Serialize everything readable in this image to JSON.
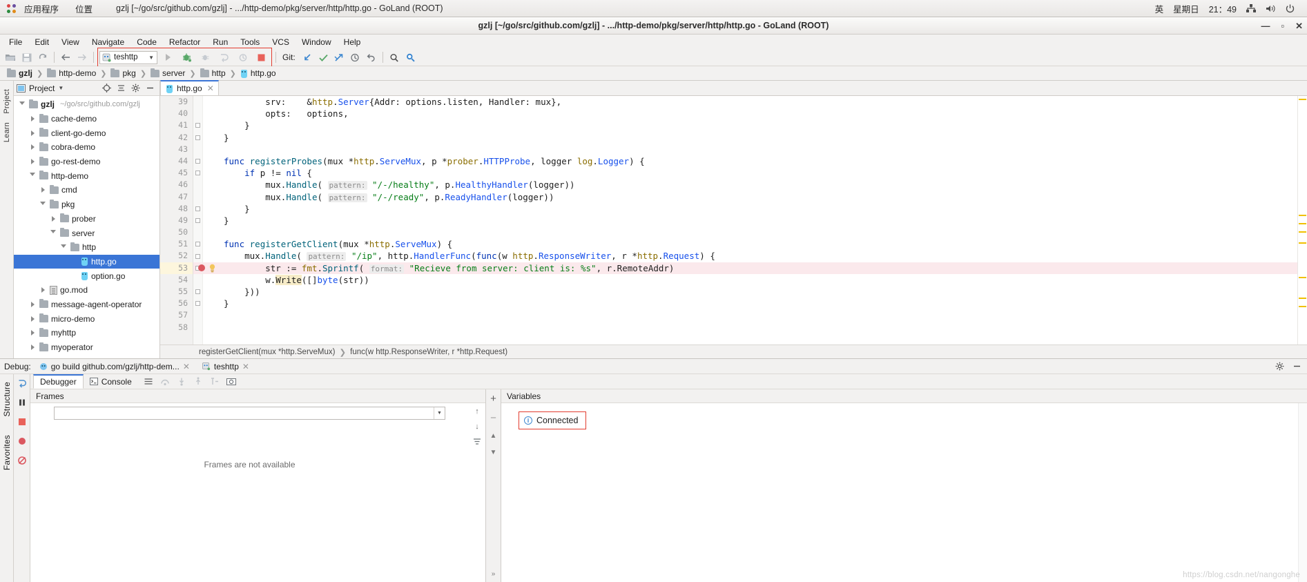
{
  "desktop": {
    "applications_label": "应用程序",
    "places_label": "位置",
    "window_title": "gzlj [~/go/src/github.com/gzlj] - .../http-demo/pkg/server/http/http.go - GoLand (ROOT)",
    "input_method": "英",
    "day": "星期日",
    "time": "21：49",
    "icons": {
      "apps": "apps-grid-icon",
      "network": "network-icon",
      "volume": "volume-icon",
      "power": "power-icon"
    }
  },
  "ide": {
    "title": "gzlj [~/go/src/github.com/gzlj] - .../http-demo/pkg/server/http/http.go - GoLand (ROOT)",
    "window_buttons": {
      "minimize": "—",
      "maximize": "▫",
      "close": "✕"
    },
    "menu": [
      "File",
      "Edit",
      "View",
      "Navigate",
      "Code",
      "Refactor",
      "Run",
      "Tools",
      "VCS",
      "Window",
      "Help"
    ],
    "toolbar": {
      "run_config": "teshttp",
      "git_label": "Git:",
      "icons": [
        "open-folder-icon",
        "save-all-icon",
        "sync-icon",
        "back-arrow-icon",
        "forward-arrow-icon",
        "run-icon",
        "debug-icon",
        "run-with-coverage-icon",
        "rerun-icon",
        "profile-icon",
        "stop-icon",
        "git-update-icon",
        "git-commit-icon",
        "git-push-icon",
        "git-history-icon",
        "git-revert-icon",
        "search-everywhere-icon",
        "find-icon"
      ]
    },
    "breadcrumbs": [
      "gzlj",
      "http-demo",
      "pkg",
      "server",
      "http",
      "http.go"
    ]
  },
  "project_panel": {
    "title": "Project",
    "header_icons": [
      "locate-icon",
      "collapse-all-icon",
      "settings-icon",
      "hide-icon"
    ],
    "tree": [
      {
        "label": "gzlj",
        "path": "~/go/src/github.com/gzlj",
        "depth": 0,
        "icon": "folder-icon",
        "state": "open",
        "bold": true,
        "selected": false
      },
      {
        "label": "cache-demo",
        "path": "",
        "depth": 1,
        "icon": "folder-icon",
        "state": "closed",
        "bold": false,
        "selected": false
      },
      {
        "label": "client-go-demo",
        "path": "",
        "depth": 1,
        "icon": "folder-icon",
        "state": "closed",
        "bold": false,
        "selected": false
      },
      {
        "label": "cobra-demo",
        "path": "",
        "depth": 1,
        "icon": "folder-icon",
        "state": "closed",
        "bold": false,
        "selected": false
      },
      {
        "label": "go-rest-demo",
        "path": "",
        "depth": 1,
        "icon": "folder-icon",
        "state": "closed",
        "bold": false,
        "selected": false
      },
      {
        "label": "http-demo",
        "path": "",
        "depth": 1,
        "icon": "folder-icon",
        "state": "open",
        "bold": false,
        "selected": false
      },
      {
        "label": "cmd",
        "path": "",
        "depth": 2,
        "icon": "folder-icon",
        "state": "closed",
        "bold": false,
        "selected": false
      },
      {
        "label": "pkg",
        "path": "",
        "depth": 2,
        "icon": "folder-icon",
        "state": "open",
        "bold": false,
        "selected": false
      },
      {
        "label": "prober",
        "path": "",
        "depth": 3,
        "icon": "folder-icon",
        "state": "closed",
        "bold": false,
        "selected": false
      },
      {
        "label": "server",
        "path": "",
        "depth": 3,
        "icon": "folder-icon",
        "state": "open",
        "bold": false,
        "selected": false
      },
      {
        "label": "http",
        "path": "",
        "depth": 4,
        "icon": "folder-icon",
        "state": "open",
        "bold": false,
        "selected": false
      },
      {
        "label": "http.go",
        "path": "",
        "depth": 5,
        "icon": "go-file-icon",
        "state": "none",
        "bold": false,
        "selected": true
      },
      {
        "label": "option.go",
        "path": "",
        "depth": 5,
        "icon": "go-file-icon",
        "state": "none",
        "bold": false,
        "selected": false
      },
      {
        "label": "go.mod",
        "path": "",
        "depth": 2,
        "icon": "go-mod-icon",
        "state": "closed",
        "bold": false,
        "selected": false
      },
      {
        "label": "message-agent-operator",
        "path": "",
        "depth": 1,
        "icon": "folder-icon",
        "state": "closed",
        "bold": false,
        "selected": false
      },
      {
        "label": "micro-demo",
        "path": "",
        "depth": 1,
        "icon": "folder-icon",
        "state": "closed",
        "bold": false,
        "selected": false
      },
      {
        "label": "myhttp",
        "path": "",
        "depth": 1,
        "icon": "folder-icon",
        "state": "closed",
        "bold": false,
        "selected": false
      },
      {
        "label": "myoperator",
        "path": "",
        "depth": 1,
        "icon": "folder-icon",
        "state": "closed",
        "bold": false,
        "selected": false
      }
    ]
  },
  "left_strip": [
    "Project",
    "Learn"
  ],
  "bottom_left_strip": [
    "Structure",
    "Favorites"
  ],
  "editor": {
    "tab": {
      "label": "http.go",
      "icon": "go-file-icon",
      "close": "✕"
    },
    "first_line": 39,
    "lines": [
      {
        "n": 39,
        "tokens": [
          {
            "t": "        srv:    &",
            "c": "pln"
          },
          {
            "t": "http",
            "c": "pkgv"
          },
          {
            "t": ".",
            "c": "pln"
          },
          {
            "t": "Server",
            "c": "typ"
          },
          {
            "t": "{Addr: options.listen, Handler: mux},",
            "c": "pln"
          }
        ]
      },
      {
        "n": 40,
        "tokens": [
          {
            "t": "        opts:   options,",
            "c": "pln"
          }
        ]
      },
      {
        "n": 41,
        "tokens": [
          {
            "t": "    }",
            "c": "pln"
          }
        ]
      },
      {
        "n": 42,
        "tokens": [
          {
            "t": "}",
            "c": "pln"
          }
        ]
      },
      {
        "n": 43,
        "tokens": []
      },
      {
        "n": 44,
        "tokens": [
          {
            "t": "func ",
            "c": "kw"
          },
          {
            "t": "registerProbes",
            "c": "fn"
          },
          {
            "t": "(mux *",
            "c": "pln"
          },
          {
            "t": "http",
            "c": "pkgv"
          },
          {
            "t": ".",
            "c": "pln"
          },
          {
            "t": "ServeMux",
            "c": "typ"
          },
          {
            "t": ", p *",
            "c": "pln"
          },
          {
            "t": "prober",
            "c": "pkgv"
          },
          {
            "t": ".",
            "c": "pln"
          },
          {
            "t": "HTTPProbe",
            "c": "typ"
          },
          {
            "t": ", logger ",
            "c": "pln"
          },
          {
            "t": "log",
            "c": "pkgv"
          },
          {
            "t": ".",
            "c": "pln"
          },
          {
            "t": "Logger",
            "c": "typ"
          },
          {
            "t": ") {",
            "c": "pln"
          }
        ]
      },
      {
        "n": 45,
        "tokens": [
          {
            "t": "    ",
            "c": "pln"
          },
          {
            "t": "if",
            "c": "kw"
          },
          {
            "t": " p != ",
            "c": "pln"
          },
          {
            "t": "nil",
            "c": "kw"
          },
          {
            "t": " {",
            "c": "pln"
          }
        ]
      },
      {
        "n": 46,
        "tokens": [
          {
            "t": "        mux.",
            "c": "pln"
          },
          {
            "t": "Handle",
            "c": "fn"
          },
          {
            "t": "( ",
            "c": "pln"
          },
          {
            "t": "pattern:",
            "c": "hint"
          },
          {
            "t": " ",
            "c": "pln"
          },
          {
            "t": "\"/-/healthy\"",
            "c": "str"
          },
          {
            "t": ", p.",
            "c": "pln"
          },
          {
            "t": "HealthyHandler",
            "c": "typ"
          },
          {
            "t": "(logger))",
            "c": "pln"
          }
        ]
      },
      {
        "n": 47,
        "tokens": [
          {
            "t": "        mux.",
            "c": "pln"
          },
          {
            "t": "Handle",
            "c": "fn"
          },
          {
            "t": "( ",
            "c": "pln"
          },
          {
            "t": "pattern:",
            "c": "hint"
          },
          {
            "t": " ",
            "c": "pln"
          },
          {
            "t": "\"/-/ready\"",
            "c": "str"
          },
          {
            "t": ", p.",
            "c": "pln"
          },
          {
            "t": "ReadyHandler",
            "c": "typ"
          },
          {
            "t": "(logger))",
            "c": "pln"
          }
        ]
      },
      {
        "n": 48,
        "tokens": [
          {
            "t": "    }",
            "c": "pln"
          }
        ]
      },
      {
        "n": 49,
        "tokens": [
          {
            "t": "}",
            "c": "pln"
          }
        ]
      },
      {
        "n": 50,
        "tokens": []
      },
      {
        "n": 51,
        "tokens": [
          {
            "t": "func ",
            "c": "kw"
          },
          {
            "t": "registerGetClient",
            "c": "fn"
          },
          {
            "t": "(mux *",
            "c": "pln"
          },
          {
            "t": "http",
            "c": "pkgv"
          },
          {
            "t": ".",
            "c": "pln"
          },
          {
            "t": "ServeMux",
            "c": "typ"
          },
          {
            "t": ") {",
            "c": "pln"
          }
        ]
      },
      {
        "n": 52,
        "tokens": [
          {
            "t": "    mux.",
            "c": "pln"
          },
          {
            "t": "Handle",
            "c": "fn"
          },
          {
            "t": "( ",
            "c": "pln"
          },
          {
            "t": "pattern:",
            "c": "hint"
          },
          {
            "t": " ",
            "c": "pln"
          },
          {
            "t": "\"/ip\"",
            "c": "str"
          },
          {
            "t": ", http.",
            "c": "pln"
          },
          {
            "t": "HandlerFunc",
            "c": "typ"
          },
          {
            "t": "(",
            "c": "pln"
          },
          {
            "t": "func",
            "c": "kw"
          },
          {
            "t": "(w ",
            "c": "pln"
          },
          {
            "t": "http",
            "c": "pkgv"
          },
          {
            "t": ".",
            "c": "pln"
          },
          {
            "t": "ResponseWriter",
            "c": "typ"
          },
          {
            "t": ", r *",
            "c": "pln"
          },
          {
            "t": "http",
            "c": "pkgv"
          },
          {
            "t": ".",
            "c": "pln"
          },
          {
            "t": "Request",
            "c": "typ"
          },
          {
            "t": ") {",
            "c": "pln"
          }
        ]
      },
      {
        "n": 53,
        "tokens": [
          {
            "t": "        str := ",
            "c": "pln"
          },
          {
            "t": "fmt",
            "c": "pkgv"
          },
          {
            "t": ".",
            "c": "pln"
          },
          {
            "t": "Sprintf",
            "c": "fn"
          },
          {
            "t": "( ",
            "c": "pln"
          },
          {
            "t": "format:",
            "c": "hint"
          },
          {
            "t": " ",
            "c": "pln"
          },
          {
            "t": "\"Recieve from server: client is: %s\"",
            "c": "str"
          },
          {
            "t": ", r.RemoteAddr)",
            "c": "pln"
          }
        ]
      },
      {
        "n": 54,
        "tokens": [
          {
            "t": "        w.",
            "c": "pln"
          },
          {
            "t": "Write",
            "c": "wr"
          },
          {
            "t": "([]",
            "c": "pln"
          },
          {
            "t": "byte",
            "c": "typ"
          },
          {
            "t": "(str))",
            "c": "pln"
          }
        ]
      },
      {
        "n": 55,
        "tokens": [
          {
            "t": "    }))",
            "c": "pln"
          }
        ]
      },
      {
        "n": 56,
        "tokens": [
          {
            "t": "}",
            "c": "pln"
          }
        ]
      },
      {
        "n": 57,
        "tokens": []
      },
      {
        "n": 58,
        "tokens": []
      }
    ],
    "breakpoint_line": 53,
    "highlighted_line": 53,
    "intention_icon": "lightbulb-icon",
    "breakpoint_icon": "breakpoint-icon",
    "footer_crumbs": [
      "registerGetClient(mux *http.ServeMux)",
      "func(w http.ResponseWriter, r *http.Request)"
    ]
  },
  "debug": {
    "label": "Debug:",
    "session_tab": "go build github.com/gzlj/http-dem...",
    "config_tab": "teshttp",
    "tabs": [
      "Debugger",
      "Console"
    ],
    "active_tab": "Debugger",
    "frames_title": "Frames",
    "variables_title": "Variables",
    "frames_empty_text": "Frames are not available",
    "frames_thread_value": "",
    "connected_text": "Connected",
    "icons": [
      "settings-icon",
      "hide-icon",
      "restore-layout-icon",
      "mute-breakpoints-icon",
      "step-over-icon",
      "step-into-icon",
      "step-out-icon",
      "evaluate-icon",
      "resume-icon",
      "pause-icon",
      "stop-icon",
      "view-breakpoints-icon",
      "camera-icon"
    ]
  },
  "watermark": "https://blog.csdn.net/nangonghe",
  "colors": {
    "accent_blue": "#3a75d6",
    "selection_blue": "#3a75d6",
    "breakpoint_red": "#db5860",
    "highlight_pink": "#fbe9ec",
    "red_box": "#e23b2e",
    "keyword": "#0033b3",
    "string": "#067d17",
    "type": "#1750eb",
    "package": "#8a6d00",
    "function": "#00627a"
  }
}
